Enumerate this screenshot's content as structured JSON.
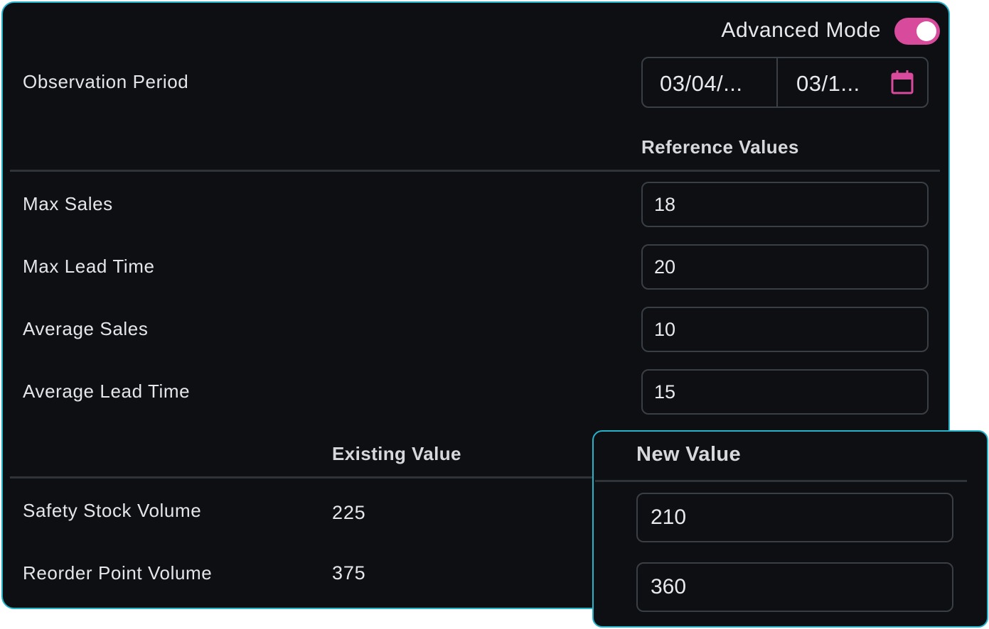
{
  "colors": {
    "accent_border": "#26b3c9",
    "toggle_on": "#d84a9c",
    "panel_bg": "#0d0f12"
  },
  "advanced_mode": {
    "label": "Advanced Mode",
    "enabled": true
  },
  "observation_period": {
    "label": "Observation Period",
    "start_display": "03/04/...",
    "end_display": "03/1...",
    "icon": "calendar-icon"
  },
  "reference": {
    "header": "Reference Values",
    "rows": [
      {
        "label": "Max Sales",
        "value": "18"
      },
      {
        "label": "Max Lead Time",
        "value": "20"
      },
      {
        "label": "Average Sales",
        "value": "10"
      },
      {
        "label": "Average Lead Time",
        "value": "15"
      }
    ]
  },
  "results": {
    "existing_header": "Existing Value",
    "new_header": "New Value",
    "rows": [
      {
        "label": "Safety Stock Volume",
        "existing": "225",
        "new": "210"
      },
      {
        "label": "Reorder Point Volume",
        "existing": "375",
        "new": "360"
      }
    ]
  }
}
